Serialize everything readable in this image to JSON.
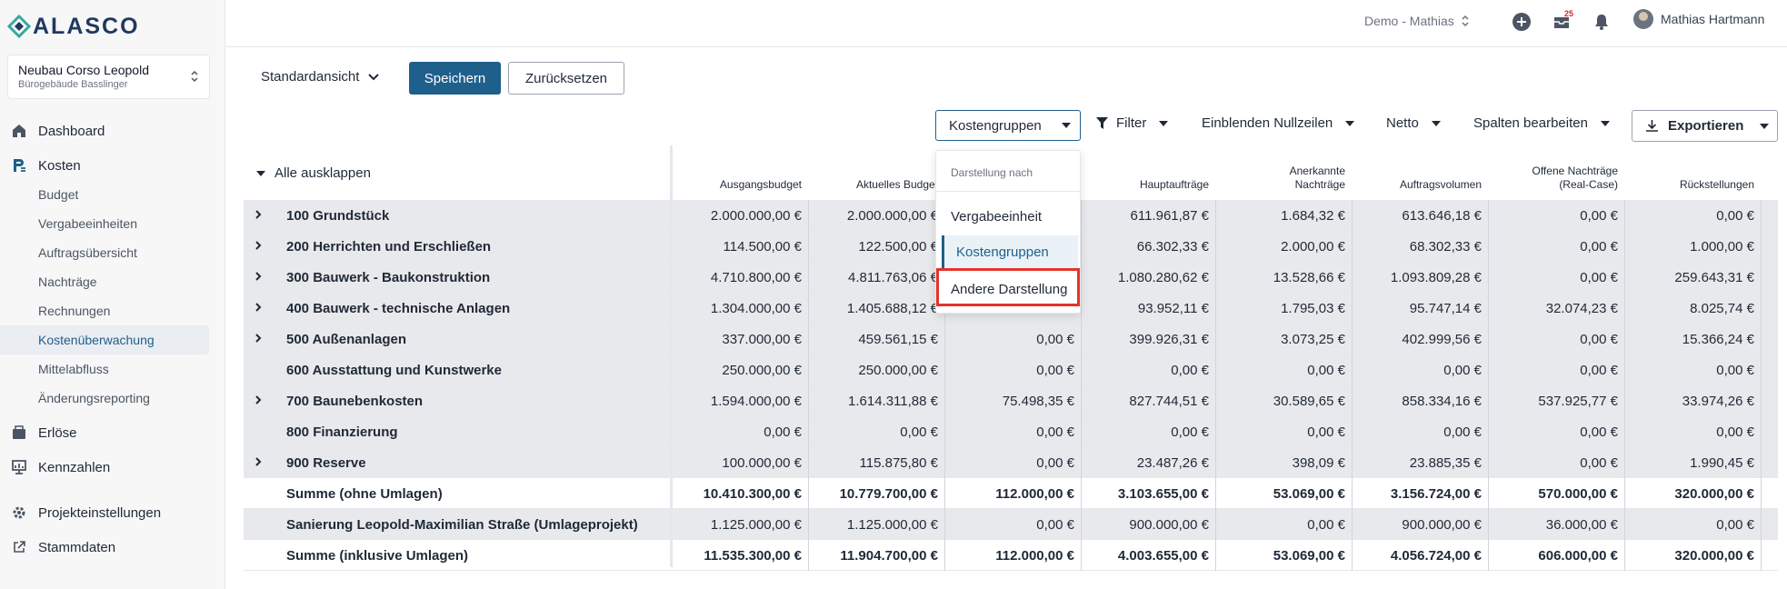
{
  "brand": {
    "logo_text": "ALASCO"
  },
  "project": {
    "name": "Neubau Corso Leopold",
    "subtitle": "Bürogebäude Basslinger"
  },
  "nav": {
    "dashboard": "Dashboard",
    "kosten": "Kosten",
    "kosten_sub": [
      "Budget",
      "Vergabeeinheiten",
      "Auftragsübersicht",
      "Nachträge",
      "Rechnungen",
      "Kostenüberwachung",
      "Mittelabfluss",
      "Änderungsreporting"
    ],
    "active_sub": "Kostenüberwachung",
    "erloese": "Erlöse",
    "kennzahlen": "Kennzahlen",
    "projekteinstellungen": "Projekteinstellungen",
    "stammdaten": "Stammdaten"
  },
  "topbar": {
    "workspace": "Demo - Mathias",
    "notification_count": "25",
    "user_name": "Mathias Hartmann"
  },
  "view": {
    "current": "Standardansicht",
    "save_label": "Speichern",
    "reset_label": "Zurücksetzen"
  },
  "toolbar": {
    "grouping": "Kostengruppen",
    "filter": "Filter",
    "nullrows": "Einblenden Nullzeilen",
    "netto": "Netto",
    "columns": "Spalten bearbeiten",
    "export": "Exportieren"
  },
  "dropdown": {
    "header": "Darstellung nach",
    "items": [
      "Vergabeeinheit",
      "Kostengruppen",
      "Andere Darstellung"
    ],
    "selected": "Kostengruppen",
    "highlighted": "Andere Darstellung"
  },
  "table": {
    "expand_all": "Alle ausklappen",
    "columns": [
      {
        "line1": "",
        "line2": "Ausgangsbudget"
      },
      {
        "line1": "",
        "line2": "Aktuelles Budget"
      },
      {
        "line1": "",
        "line2": ""
      },
      {
        "line1": "",
        "line2": "Hauptaufträge"
      },
      {
        "line1": "Anerkannte",
        "line2": "Nachträge"
      },
      {
        "line1": "",
        "line2": "Auftragsvolumen"
      },
      {
        "line1": "Offene Nachträge",
        "line2": "(Real-Case)"
      },
      {
        "line1": "",
        "line2": "Rückstellungen"
      }
    ],
    "rows": [
      {
        "label": "100 Grundstück",
        "expandable": true,
        "shade": "grey",
        "bold": false,
        "values": [
          "2.000.000,00 €",
          "2.000.000,00 €",
          "",
          "611.961,87 €",
          "1.684,32 €",
          "613.646,18 €",
          "0,00 €",
          "0,00 €"
        ]
      },
      {
        "label": "200 Herrichten und Erschließen",
        "expandable": true,
        "shade": "grey",
        "bold": false,
        "values": [
          "114.500,00 €",
          "122.500,00 €",
          "",
          "66.302,33 €",
          "2.000,00 €",
          "68.302,33 €",
          "0,00 €",
          "1.000,00 €"
        ]
      },
      {
        "label": "300 Bauwerk - Baukonstruktion",
        "expandable": true,
        "shade": "grey",
        "bold": false,
        "values": [
          "4.710.800,00 €",
          "4.811.763,06 €",
          "",
          "1.080.280,62 €",
          "13.528,66 €",
          "1.093.809,28 €",
          "0,00 €",
          "259.643,31 €"
        ]
      },
      {
        "label": "400 Bauwerk - technische Anlagen",
        "expandable": true,
        "shade": "grey",
        "bold": false,
        "values": [
          "1.304.000,00 €",
          "1.405.688,12 €",
          "",
          "93.952,11 €",
          "1.795,03 €",
          "95.747,14 €",
          "32.074,23 €",
          "8.025,74 €"
        ]
      },
      {
        "label": "500 Außenanlagen",
        "expandable": true,
        "shade": "grey",
        "bold": false,
        "values": [
          "337.000,00 €",
          "459.561,15 €",
          "0,00 €",
          "399.926,31 €",
          "3.073,25 €",
          "402.999,56 €",
          "0,00 €",
          "15.366,24 €"
        ]
      },
      {
        "label": "600 Ausstattung und Kunstwerke",
        "expandable": false,
        "shade": "grey",
        "bold": false,
        "values": [
          "250.000,00 €",
          "250.000,00 €",
          "0,00 €",
          "0,00 €",
          "0,00 €",
          "0,00 €",
          "0,00 €",
          "0,00 €"
        ]
      },
      {
        "label": "700 Baunebenkosten",
        "expandable": true,
        "shade": "grey",
        "bold": false,
        "values": [
          "1.594.000,00 €",
          "1.614.311,88 €",
          "75.498,35 €",
          "827.744,51 €",
          "30.589,65 €",
          "858.334,16 €",
          "537.925,77 €",
          "33.974,26 €"
        ]
      },
      {
        "label": "800 Finanzierung",
        "expandable": false,
        "shade": "grey",
        "bold": false,
        "values": [
          "0,00 €",
          "0,00 €",
          "0,00 €",
          "0,00 €",
          "0,00 €",
          "0,00 €",
          "0,00 €",
          "0,00 €"
        ]
      },
      {
        "label": "900 Reserve",
        "expandable": true,
        "shade": "grey",
        "bold": false,
        "values": [
          "100.000,00 €",
          "115.875,80 €",
          "0,00 €",
          "23.487,26 €",
          "398,09 €",
          "23.885,35 €",
          "0,00 €",
          "1.990,45 €"
        ]
      },
      {
        "label": "Summe (ohne Umlagen)",
        "expandable": false,
        "shade": "white",
        "bold": true,
        "values": [
          "10.410.300,00 €",
          "10.779.700,00 €",
          "112.000,00 €",
          "3.103.655,00 €",
          "53.069,00 €",
          "3.156.724,00 €",
          "570.000,00 €",
          "320.000,00 €"
        ]
      },
      {
        "label": "Sanierung Leopold-Maximilian Straße (Umlageprojekt)",
        "expandable": false,
        "shade": "grey",
        "bold": false,
        "values": [
          "1.125.000,00 €",
          "1.125.000,00 €",
          "0,00 €",
          "900.000,00 €",
          "0,00 €",
          "900.000,00 €",
          "36.000,00 €",
          "0,00 €"
        ]
      },
      {
        "label": "Summe (inklusive Umlagen)",
        "expandable": false,
        "shade": "white",
        "bold": true,
        "values": [
          "11.535.300,00 €",
          "11.904.700,00 €",
          "112.000,00 €",
          "4.003.655,00 €",
          "53.069,00 €",
          "4.056.724,00 €",
          "606.000,00 €",
          "320.000,00 €"
        ]
      }
    ]
  },
  "colors": {
    "primary": "#1f5f8b",
    "highlight": "#e5332a",
    "row_grey": "#e8e9ec"
  }
}
